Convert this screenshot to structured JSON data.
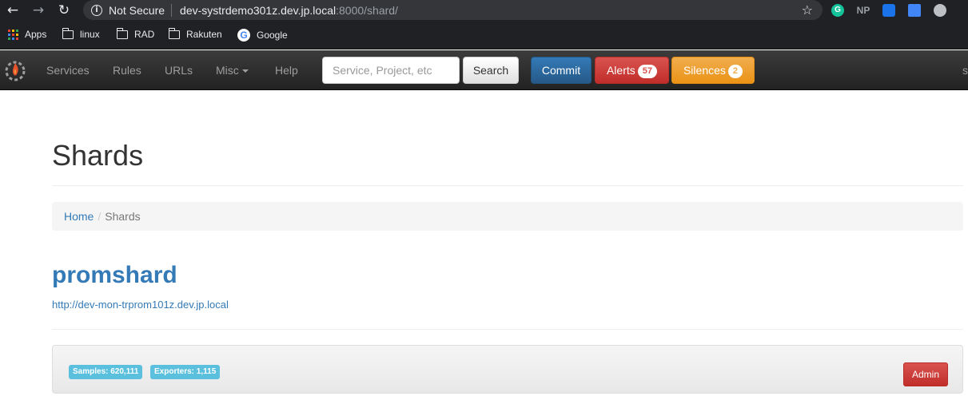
{
  "browser": {
    "back_icon": "←",
    "forward_icon": "→",
    "reload_icon": "↻",
    "security_label": "Not Secure",
    "url_host": "dev-systrdemo301z.dev.jp.local",
    "url_rest": ":8000/shard/",
    "star_icon": "☆",
    "extensions": [
      "G",
      "NP",
      "",
      "",
      ""
    ]
  },
  "bookmarks": [
    {
      "label": "Apps",
      "icon": "apps-grid-icon"
    },
    {
      "label": "linux",
      "icon": "folder-icon"
    },
    {
      "label": "RAD",
      "icon": "folder-icon"
    },
    {
      "label": "Rakuten",
      "icon": "folder-icon"
    },
    {
      "label": "Google",
      "icon": "google-icon"
    }
  ],
  "navbar": {
    "links": [
      "Services",
      "Rules",
      "URLs",
      "Misc",
      "Help"
    ],
    "search_placeholder": "Service, Project, etc",
    "search_label": "Search",
    "commit_label": "Commit",
    "alerts_label": "Alerts",
    "alerts_count": "57",
    "silences_label": "Silences",
    "silences_count": "2",
    "user_initial": "s"
  },
  "page": {
    "title": "Shards",
    "breadcrumb": {
      "home": "Home",
      "current": "Shards"
    },
    "shard": {
      "name": "promshard",
      "url": "http://dev-mon-trprom101z.dev.jp.local",
      "samples": "Samples: 620,111",
      "exporters": "Exporters: 1,115",
      "admin_label": "Admin"
    }
  },
  "colors": {
    "primary": "#337ab7",
    "danger": "#d9534f",
    "warning": "#f0ad4e",
    "info": "#5bc0de",
    "navbar": "#222222"
  }
}
